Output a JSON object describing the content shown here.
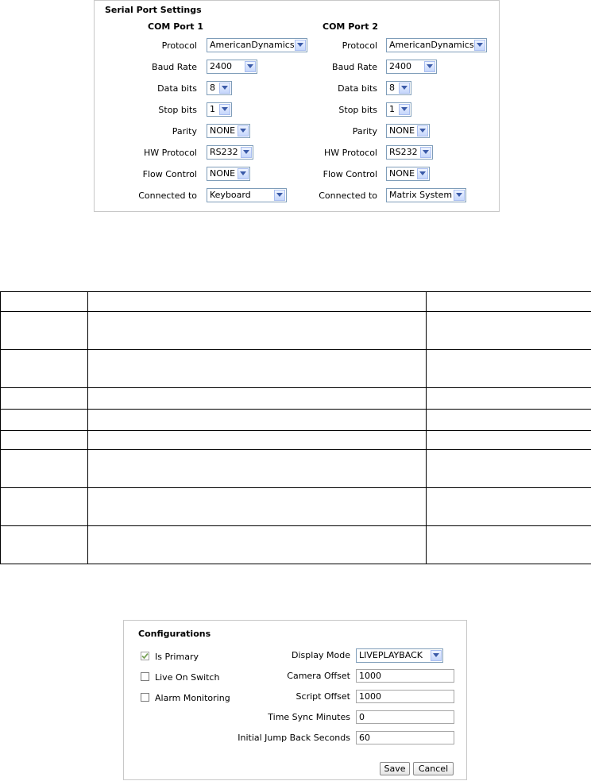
{
  "serial_panel": {
    "title": "Serial Port Settings",
    "com1": {
      "heading": "COM Port 1",
      "fields": [
        {
          "label": "Protocol",
          "value": "AmericanDynamics"
        },
        {
          "label": "Baud Rate",
          "value": "2400"
        },
        {
          "label": "Data bits",
          "value": "8"
        },
        {
          "label": "Stop bits",
          "value": "1"
        },
        {
          "label": "Parity",
          "value": "NONE"
        },
        {
          "label": "HW Protocol",
          "value": "RS232"
        },
        {
          "label": "Flow Control",
          "value": "NONE"
        },
        {
          "label": "Connected to",
          "value": "Keyboard"
        }
      ]
    },
    "com2": {
      "heading": "COM Port 2",
      "fields": [
        {
          "label": "Protocol",
          "value": "AmericanDynamics"
        },
        {
          "label": "Baud Rate",
          "value": "2400"
        },
        {
          "label": "Data bits",
          "value": "8"
        },
        {
          "label": "Stop bits",
          "value": "1"
        },
        {
          "label": "Parity",
          "value": "NONE"
        },
        {
          "label": "HW Protocol",
          "value": "RS232"
        },
        {
          "label": "Flow Control",
          "value": "NONE"
        },
        {
          "label": "Connected to",
          "value": "Matrix System"
        }
      ]
    }
  },
  "config_panel": {
    "title": "Configurations",
    "checkboxes": [
      {
        "label": "Is Primary",
        "checked": true
      },
      {
        "label": "Live On Switch",
        "checked": false
      },
      {
        "label": "Alarm Monitoring",
        "checked": false
      }
    ],
    "display_mode": {
      "label": "Display Mode",
      "value": "LIVEPLAYBACK"
    },
    "inputs": [
      {
        "label": "Camera Offset",
        "value": "1000"
      },
      {
        "label": "Script Offset",
        "value": "1000"
      },
      {
        "label": "Time Sync Minutes",
        "value": "0"
      },
      {
        "label": "Initial Jump Back Seconds",
        "value": "60"
      }
    ],
    "save_label": "Save",
    "cancel_label": "Cancel"
  },
  "colors": {
    "select_border": "#7f9db9",
    "arrow_fill": "#c5d6fb",
    "check_green": "#7aa35a"
  }
}
